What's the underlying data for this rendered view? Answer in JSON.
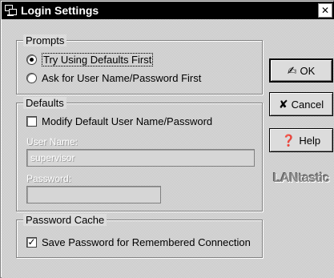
{
  "window": {
    "title": "Login Settings",
    "close_label": "✕"
  },
  "prompts": {
    "legend": "Prompts",
    "option_defaults_first": "Try Using Defaults First",
    "option_ask_first": "Ask for User Name/Password First",
    "selected": "option_defaults_first"
  },
  "defaults": {
    "legend": "Defaults",
    "modify_checkbox_label": "Modify Default User Name/Password",
    "modify_checked": false,
    "username_label": "User Name:",
    "username_value": "supervisor",
    "password_label": "Password:",
    "password_value": ""
  },
  "cache": {
    "legend": "Password Cache",
    "save_checkbox_label": "Save Password for Remembered Connection",
    "save_checked": true,
    "check_mark": "✓"
  },
  "buttons": {
    "ok": "OK",
    "cancel": "Cancel",
    "help": "Help"
  },
  "logo": {
    "text": "LANtastic"
  }
}
